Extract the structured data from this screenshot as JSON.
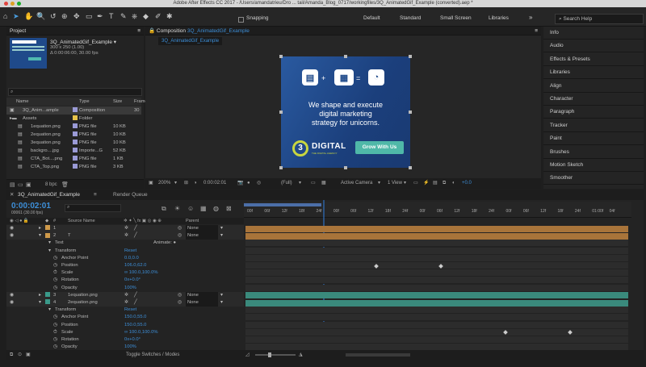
{
  "mac": {
    "title": "Adobe After Effects CC 2017 - /Users/amandatrieu/Dro ... tail/Amanda_Blog_0717/workingfiles/3Q_AnimatedGif_Example (converted).aep *"
  },
  "toolbar": {
    "snapping_label": "Snapping",
    "workspaces": [
      "Default",
      "Standard",
      "Small Screen",
      "Libraries"
    ],
    "search_placeholder": "Search Help"
  },
  "project": {
    "title": "Project",
    "comp_name": "3Q_AnimatedGif_Example ▾",
    "comp_size": "300 x 250 (1.00)",
    "comp_duration": "Δ 0:00:06:00, 30.00 fps",
    "col_name": "Name",
    "col_type": "Type",
    "col_size": "Size",
    "col_frame": "Frame",
    "items": [
      {
        "name": "3Q_Anim...ample",
        "type": "Composition",
        "size": "",
        "frame": "30",
        "color": "#9a9ad6",
        "icon": "composition-icon"
      },
      {
        "name": "Assets",
        "type": "Folder",
        "size": "",
        "frame": "",
        "color": "#e6c24a",
        "icon": "folder-icon"
      },
      {
        "name": "1equation.png",
        "type": "PNG file",
        "size": "10 KB",
        "frame": "",
        "color": "#9a9ad6",
        "icon": "image-file-icon"
      },
      {
        "name": "2equation.png",
        "type": "PNG file",
        "size": "10 KB",
        "frame": "",
        "color": "#9a9ad6",
        "icon": "image-file-icon"
      },
      {
        "name": "3equation.png",
        "type": "PNG file",
        "size": "10 KB",
        "frame": "",
        "color": "#9a9ad6",
        "icon": "image-file-icon"
      },
      {
        "name": "backgro....jpg",
        "type": "Importe...G",
        "size": "52 KB",
        "frame": "",
        "color": "#9a9ad6",
        "icon": "image-file-icon"
      },
      {
        "name": "CTA_Bot....png",
        "type": "PNG file",
        "size": "1 KB",
        "frame": "",
        "color": "#9a9ad6",
        "icon": "image-file-icon"
      },
      {
        "name": "CTA_Top.png",
        "type": "PNG file",
        "size": "3 KB",
        "frame": "",
        "color": "#9a9ad6",
        "icon": "image-file-icon"
      }
    ],
    "bpc": "8 bpc"
  },
  "comp": {
    "tab_prefix": "Composition",
    "tab_name": "3Q_AnimatedGif_Example",
    "subtab": "3Q_AnimatedGif_Example",
    "zoom": "200%",
    "time": "0:00:02:01",
    "resolution": "(Full)",
    "camera": "Active Camera",
    "view": "1 View",
    "exposure": "+0.0"
  },
  "ad": {
    "headline_1": "We shape and execute",
    "headline_2": "digital marketing",
    "headline_3": "strategy for unicorns.",
    "brand": "DIGITAL",
    "brand_mark": "3",
    "brand_sub": "THE DIGITAL AGENCY",
    "cta": "Grow With Us"
  },
  "right_panel": {
    "items": [
      "Info",
      "Audio",
      "Effects & Presets",
      "Libraries",
      "Align",
      "Character",
      "Paragraph",
      "Tracker",
      "Paint",
      "Brushes",
      "Motion Sketch",
      "Smoother"
    ]
  },
  "timeline": {
    "tab": "3Q_AnimatedGif_Example",
    "render_queue": "Render Queue",
    "time": "0:00:02:01",
    "frame_info": "00061 (30.00 fps)",
    "col_source": "Source Name",
    "col_parent": "Parent",
    "ruler": [
      "00f",
      "06f",
      "12f",
      "18f",
      "24f",
      "00f",
      "06f",
      "12f",
      "18f",
      "24f",
      "00f",
      "06f",
      "12f",
      "18f",
      "24f",
      "00f",
      "06f",
      "12f",
      "18f",
      "24f",
      "01:00f",
      "04f"
    ],
    "rows": [
      {
        "num": "1",
        "name": "",
        "parent": "None",
        "indent": 0,
        "kind": "layer",
        "color": "#cf9a4a"
      },
      {
        "num": "2",
        "name": "T",
        "parent": "None",
        "indent": 0,
        "kind": "layer",
        "color": "#cf9a4a"
      },
      {
        "num": "",
        "name": "Text",
        "parent": "",
        "indent": 1,
        "kind": "group",
        "value": "",
        "extra": "Animate: ●"
      },
      {
        "num": "",
        "name": "Transform",
        "parent": "",
        "indent": 1,
        "kind": "group",
        "value": "Reset"
      },
      {
        "num": "",
        "name": "Anchor Point",
        "parent": "",
        "indent": 2,
        "kind": "prop",
        "value": "0.0,0.0"
      },
      {
        "num": "",
        "name": "Position",
        "parent": "",
        "indent": 2,
        "kind": "prop",
        "value": "106.0,62.0"
      },
      {
        "num": "",
        "name": "Scale",
        "parent": "",
        "indent": 2,
        "kind": "prop",
        "value": "∞ 100.0,100.0%"
      },
      {
        "num": "",
        "name": "Rotation",
        "parent": "",
        "indent": 2,
        "kind": "prop",
        "value": "0x+0.0°"
      },
      {
        "num": "",
        "name": "Opacity",
        "parent": "",
        "indent": 2,
        "kind": "prop",
        "value": "100%"
      },
      {
        "num": "3",
        "name": "1equation.png",
        "parent": "None",
        "indent": 0,
        "kind": "layer",
        "color": "#3a9a8a"
      },
      {
        "num": "4",
        "name": "2equation.png",
        "parent": "None",
        "indent": 0,
        "kind": "layer",
        "color": "#3a9a8a"
      },
      {
        "num": "",
        "name": "Transform",
        "parent": "",
        "indent": 1,
        "kind": "group",
        "value": "Reset"
      },
      {
        "num": "",
        "name": "Anchor Point",
        "parent": "",
        "indent": 2,
        "kind": "prop",
        "value": "150.0,55.0"
      },
      {
        "num": "",
        "name": "Position",
        "parent": "",
        "indent": 2,
        "kind": "prop",
        "value": "150.0,55.0"
      },
      {
        "num": "",
        "name": "Scale",
        "parent": "",
        "indent": 2,
        "kind": "prop",
        "value": "∞ 100.0,100.0%"
      },
      {
        "num": "",
        "name": "Rotation",
        "parent": "",
        "indent": 2,
        "kind": "prop",
        "value": "0x+0.0°"
      },
      {
        "num": "",
        "name": "Opacity",
        "parent": "",
        "indent": 2,
        "kind": "prop",
        "value": "100%"
      }
    ],
    "toggle_label": "Toggle Switches / Modes"
  }
}
